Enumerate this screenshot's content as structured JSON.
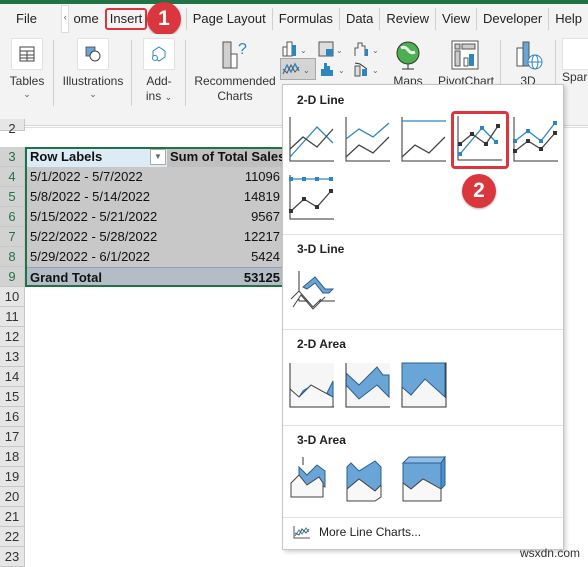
{
  "ribbon_tabs": [
    {
      "label": "File"
    },
    {
      "label": "ome"
    },
    {
      "label": "Insert",
      "active": true
    },
    {
      "label": "Page Layout"
    },
    {
      "label": "Formulas"
    },
    {
      "label": "Data"
    },
    {
      "label": "Review"
    },
    {
      "label": "View"
    },
    {
      "label": "Developer"
    },
    {
      "label": "Help"
    }
  ],
  "ribbon_groups": {
    "tables": "Tables",
    "illustrations": "Illustrations",
    "addins_1": "Add-",
    "addins_2": "ins",
    "recommended_1": "Recommended",
    "recommended_2": "Charts",
    "maps": "Maps",
    "pivotchart": "PivotChart",
    "threed": "3D",
    "sparklines": "Spar"
  },
  "annotations": {
    "step1": "1",
    "step2": "2"
  },
  "row_numbers": [
    "2",
    "3",
    "4",
    "5",
    "6",
    "7",
    "8",
    "9",
    "10",
    "11",
    "12",
    "13",
    "14",
    "15",
    "16",
    "17",
    "18",
    "19",
    "20",
    "21",
    "22",
    "23"
  ],
  "pivot": {
    "header_label": "Row Labels",
    "header_value": "Sum of Total Sales",
    "rows": [
      {
        "label": "5/1/2022 - 5/7/2022",
        "value": "11096"
      },
      {
        "label": "5/8/2022 - 5/14/2022",
        "value": "14819"
      },
      {
        "label": "5/15/2022 - 5/21/2022",
        "value": "9567"
      },
      {
        "label": "5/22/2022 - 5/28/2022",
        "value": "12217"
      },
      {
        "label": "5/29/2022 - 6/1/2022",
        "value": "5424"
      }
    ],
    "total_label": "Grand Total",
    "total_value": "53125"
  },
  "gallery": {
    "sections": [
      {
        "title": "2-D Line"
      },
      {
        "title": "3-D Line"
      },
      {
        "title": "2-D Area"
      },
      {
        "title": "3-D Area"
      }
    ],
    "more_label": "More Line Charts..."
  },
  "colors": {
    "accent": "#217346",
    "highlight": "#d9363e",
    "series_blue": "#2e86c1"
  },
  "watermark": "wsxdn.com"
}
